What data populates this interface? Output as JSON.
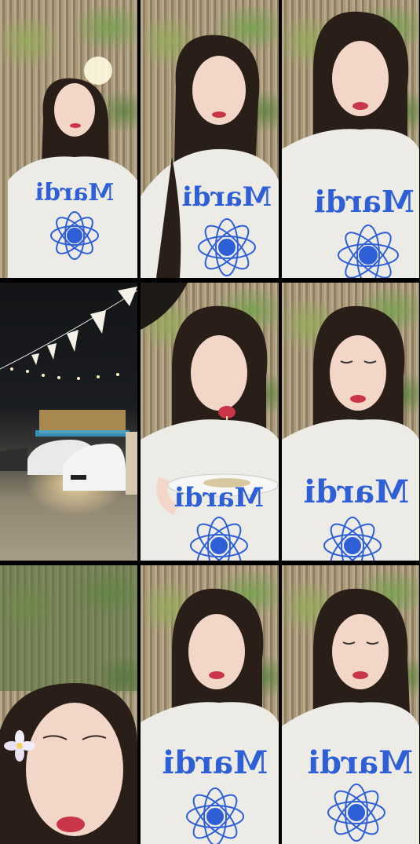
{
  "collage": {
    "layout": "3x3 photo grid",
    "background_color": "#000000",
    "shirt_text": "Mardi",
    "frames": [
      {
        "scene": "portrait-garden-night",
        "variant": "lamp"
      },
      {
        "scene": "portrait-garden"
      },
      {
        "scene": "portrait-garden-closeup"
      },
      {
        "scene": "night-parking-lot-with-string-lights"
      },
      {
        "scene": "portrait-eating-noodles"
      },
      {
        "scene": "portrait-garden-eyes-closed"
      },
      {
        "scene": "portrait-face-closeup-with-flower"
      },
      {
        "scene": "portrait-garden"
      },
      {
        "scene": "portrait-garden-eyes-closed"
      }
    ],
    "colors": {
      "shirt": "#ecebe6",
      "print_blue": "#2f5fd6",
      "hair": "#2a1e18",
      "skin": "#f2d6c8",
      "lips": "#c9364a"
    }
  }
}
